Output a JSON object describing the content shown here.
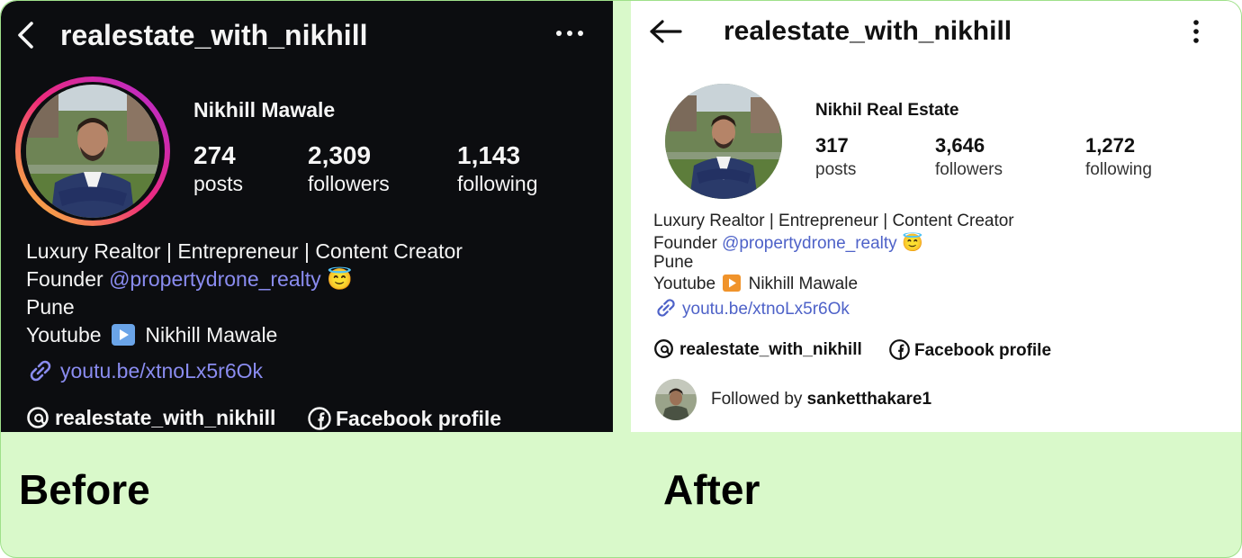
{
  "before": {
    "caption": "Before",
    "username": "realestate_with_nikhill",
    "display_name": "Nikhill Mawale",
    "stats": [
      {
        "value": "274",
        "label": "posts"
      },
      {
        "value": "2,309",
        "label": "followers"
      },
      {
        "value": "1,143",
        "label": "following"
      }
    ],
    "bio": {
      "line1": "Luxury Realtor | Entrepreneur | Content Creator",
      "founder_prefix": "Founder",
      "founder_handle": "@propertydrone_realty",
      "emoji": "😇",
      "city": "Pune",
      "youtube_prefix": "Youtube",
      "youtube_name": "Nikhill Mawale",
      "link": "youtu.be/xtnoLx5r6Ok"
    },
    "threads_label": "realestate_with_nikhill",
    "facebook_label": "Facebook profile",
    "theme": {
      "background": "#0c0d10",
      "text": "#f5f5f5",
      "link": "#8a8cf0"
    }
  },
  "after": {
    "caption": "After",
    "username": "realestate_with_nikhill",
    "display_name": "Nikhil Real Estate",
    "stats": [
      {
        "value": "317",
        "label": "posts"
      },
      {
        "value": "3,646",
        "label": "followers"
      },
      {
        "value": "1,272",
        "label": "following"
      }
    ],
    "bio": {
      "line1": "Luxury Realtor | Entrepreneur | Content Creator",
      "founder_prefix": "Founder",
      "founder_handle": "@propertydrone_realty",
      "emoji": "😇",
      "city": "Pune",
      "youtube_prefix": "Youtube",
      "youtube_name": "Nikhill Mawale",
      "link": "youtu.be/xtnoLx5r6Ok"
    },
    "threads_label": "realestate_with_nikhill",
    "facebook_label": "Facebook profile",
    "followed_by_prefix": "Followed by",
    "followed_by_user": "sanketthakare1",
    "theme": {
      "background": "#ffffff",
      "text": "#111111",
      "link": "#4e62c8"
    }
  },
  "icons": [
    "back-arrow-icon",
    "more-options-icon",
    "play-icon",
    "link-icon",
    "threads-icon",
    "facebook-icon"
  ],
  "colors": {
    "card_background": "#d9f9ca",
    "card_border": "#9fe08a",
    "story_ring": [
      "#f9ce34",
      "#ee2a7b",
      "#6228d7"
    ]
  }
}
